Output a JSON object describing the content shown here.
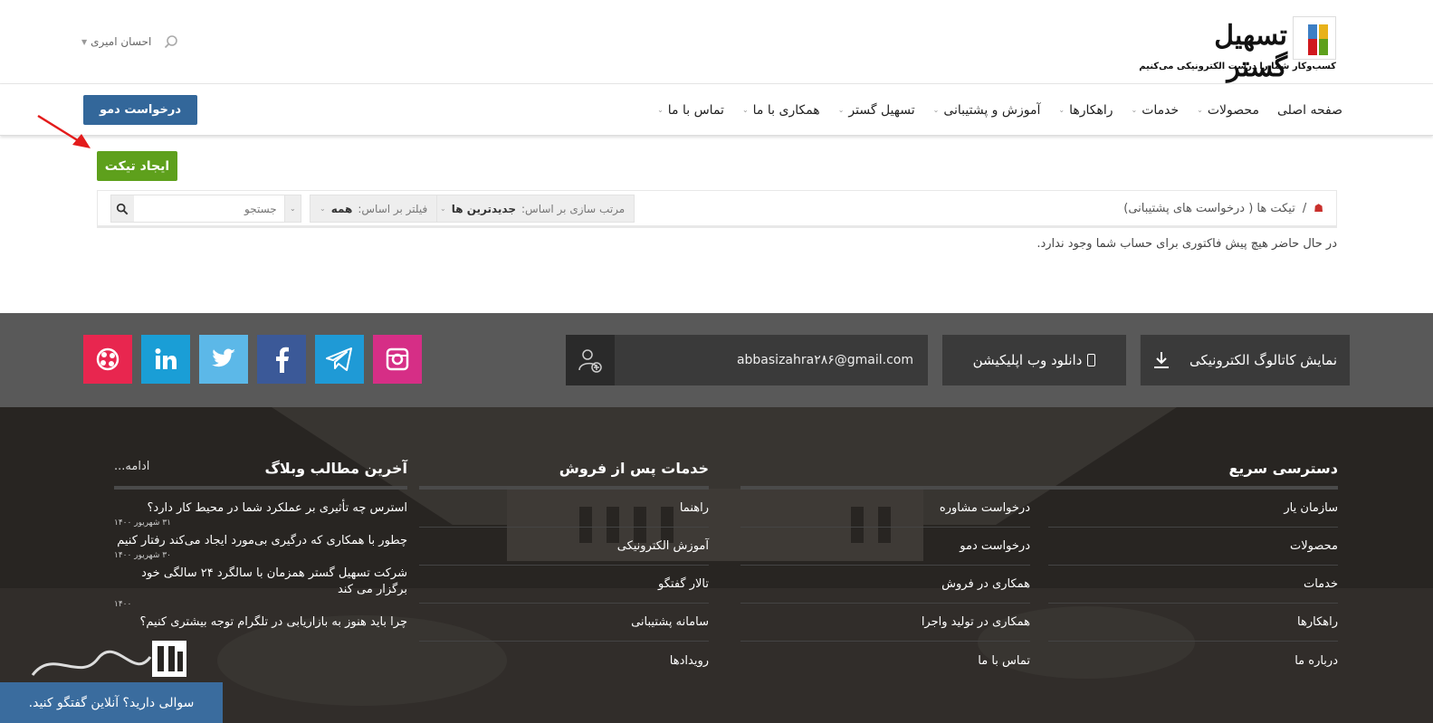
{
  "header": {
    "logo_text": "تسهیل گستر",
    "logo_tagline": "کسب‌وکار شما را درست الکترونیکی می‌کنیم",
    "user_name": "احسان امیری",
    "demo_button": "درخواست دمو"
  },
  "nav": {
    "items": [
      {
        "label": "صفحه اصلی",
        "caret": false
      },
      {
        "label": "محصولات",
        "caret": true
      },
      {
        "label": "خدمات",
        "caret": true
      },
      {
        "label": "راهکارها",
        "caret": true
      },
      {
        "label": "آموزش و پشتیبانی",
        "caret": true
      },
      {
        "label": "تسهیل گستر",
        "caret": true
      },
      {
        "label": "همکاری با ما",
        "caret": true
      },
      {
        "label": "تماس با ما",
        "caret": true
      }
    ]
  },
  "content": {
    "create_ticket": "ایجاد تیکت",
    "breadcrumb_sep": "/",
    "breadcrumb": "تیکت ها ( درخواست های پشتیبانی)",
    "sort_label": "مرتب سازی بر اساس:",
    "sort_value": "جدیدترین ها",
    "filter_label": "فیلتر بر اساس:",
    "filter_value": "همه",
    "search_placeholder": "جستجو",
    "empty_message": "در حال حاضر هیچ پیش فاکتوری برای حساب شما وجود ندارد."
  },
  "strip": {
    "catalog_button": "نمایش کاتالوگ الکترونیکی",
    "app_button": "دانلود وب اپلیکیشن",
    "email": "abbasizahra۲۸۶@gmail.com",
    "socials": [
      {
        "name": "aparat-icon",
        "color": "#e8264f"
      },
      {
        "name": "linkedin-icon",
        "color": "#1a9ed6"
      },
      {
        "name": "twitter-icon",
        "color": "#5cb8e8"
      },
      {
        "name": "facebook-icon",
        "color": "#3b5998"
      },
      {
        "name": "telegram-icon",
        "color": "#1f9ad6"
      },
      {
        "name": "instagram-icon",
        "color": "#d62e86"
      }
    ]
  },
  "footer": {
    "quick_title": "دسترسی سریع",
    "quick_col1": [
      "سازمان یار",
      "محصولات",
      "خدمات",
      "راهکارها",
      "درباره ما"
    ],
    "quick_col2": [
      "درخواست مشاوره",
      "درخواست دمو",
      "همکاری در فروش",
      "همکاری در تولید واجرا",
      "تماس با ما"
    ],
    "after_title": "خدمات پس از فروش",
    "after_links": [
      "راهنما",
      "آموزش الکترونیکی",
      "تالار گفتگو",
      "سامانه پشتیبانی",
      "رویدادها"
    ],
    "blog_title": "آخرین مطالب وبلاگ",
    "blog_more": "ادامه...",
    "posts": [
      {
        "title": "استرس چه تأثیری بر عملکرد شما در محیط کار دارد؟",
        "date": "۳۱ شهریور ۱۴۰۰"
      },
      {
        "title": "چطور با همکاری که درگیری بی‌مورد ایجاد می‌کند رفتار کنیم",
        "date": "۳۰ شهریور ۱۴۰۰"
      },
      {
        "title": "شرکت تسهیل گستر همزمان با سالگرد ۲۴ سالگی خود برگزار می کند",
        "date": "۱۴۰۰"
      },
      {
        "title": "چرا باید هنوز به بازاریابی در تلگرام توجه بیشتری کنیم؟",
        "date": ""
      }
    ]
  },
  "chat": {
    "text": "سوالی دارید؟ آنلاین گفتگو کنید."
  }
}
